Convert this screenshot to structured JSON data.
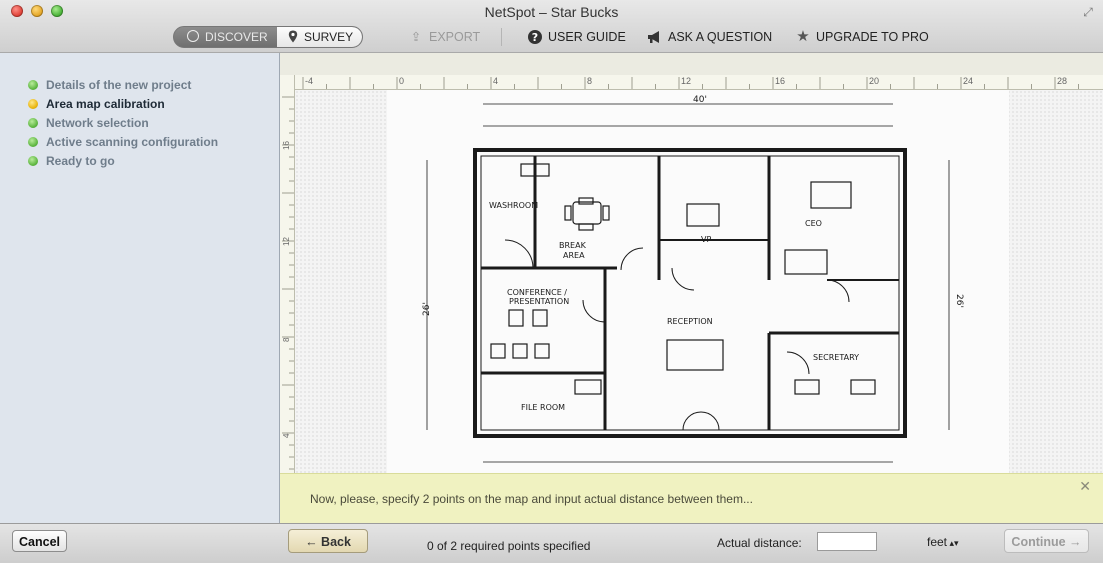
{
  "window": {
    "title": "NetSpot – Star Bucks"
  },
  "toolbar": {
    "mode_discover": "DISCOVER",
    "mode_survey": "SURVEY",
    "export": "EXPORT",
    "user_guide": "USER GUIDE",
    "ask_question": "ASK A QUESTION",
    "upgrade": "UPGRADE TO PRO"
  },
  "sidebar": {
    "steps": [
      {
        "label": "Details of the new project",
        "status": "done"
      },
      {
        "label": "Area map calibration",
        "status": "current"
      },
      {
        "label": "Network selection",
        "status": "done"
      },
      {
        "label": "Active scanning configuration",
        "status": "done"
      },
      {
        "label": "Ready to go",
        "status": "done"
      }
    ]
  },
  "ruler": {
    "h_labels": [
      "-4",
      "0",
      "4",
      "8",
      "12",
      "16",
      "20",
      "24",
      "28"
    ],
    "v_labels": [
      "16",
      "12",
      "8",
      "4"
    ]
  },
  "floorplan": {
    "rooms": [
      "WASHROOM",
      "BREAK AREA",
      "VP",
      "CEO",
      "CONFERENCE / PRESENTATION",
      "RECEPTION",
      "SECRETARY",
      "FILE ROOM"
    ],
    "dimensions": {
      "top_total": "40'",
      "left_total": "26'",
      "right_total": "26'"
    }
  },
  "hint": {
    "text": "Now, please, specify 2 points on the map and input actual distance between them..."
  },
  "bottom": {
    "cancel": "Cancel",
    "back": "← Back",
    "points_status": "0 of 2 required points specified",
    "distance_label": "Actual distance:",
    "distance_value": "",
    "unit": "feet",
    "continue": "Continue →"
  }
}
